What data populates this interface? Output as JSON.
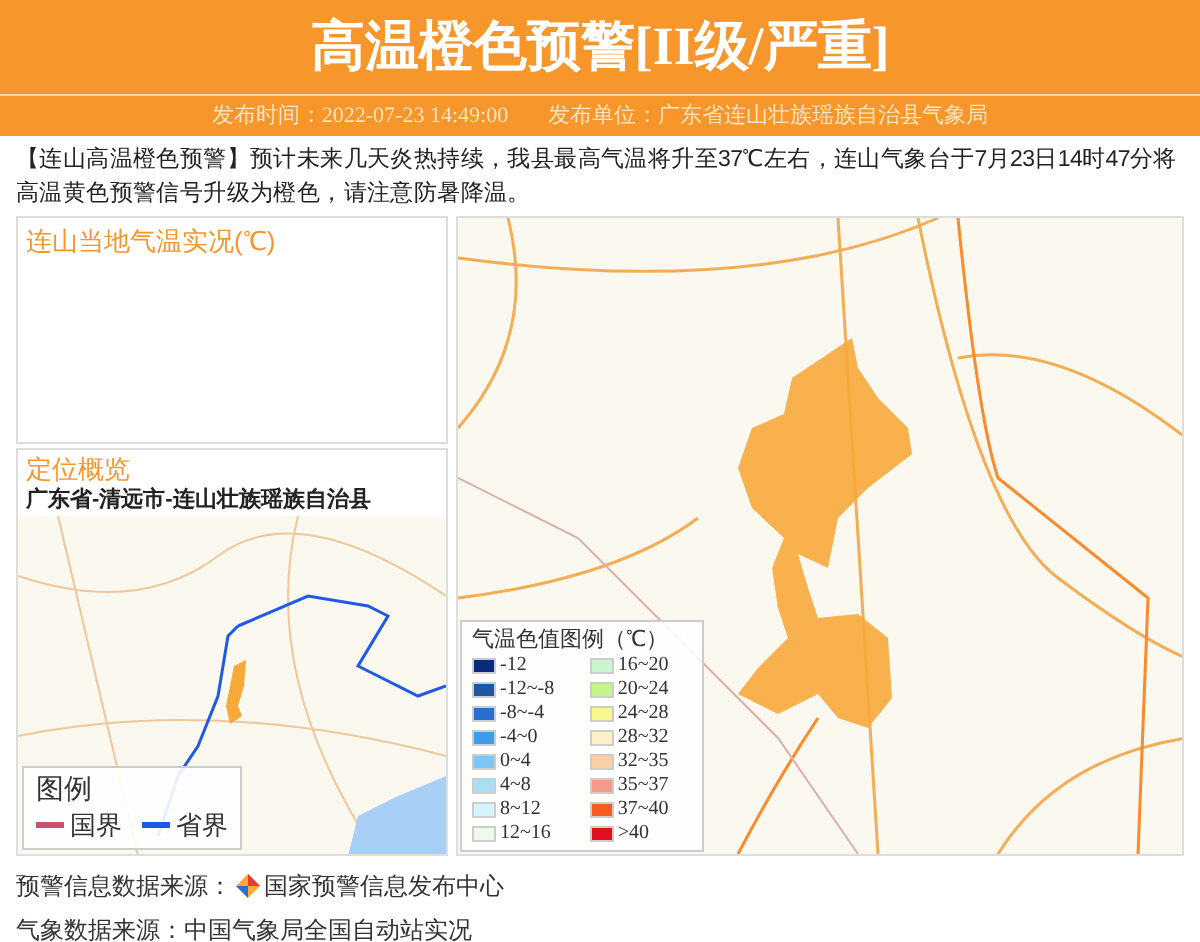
{
  "header": {
    "title": "高温橙色预警[II级/严重]",
    "publish_time": "发布时间：2022-07-23 14:49:00",
    "publisher": "发布单位：广东省连山壮族瑶族自治县气象局"
  },
  "message": "【连山高温橙色预警】预计未来几天炎热持续，我县最高气温将升至37℃左右，连山气象台于7月23日14时47分将高温黄色预警信号升级为橙色，请注意防暑降温。",
  "temperature_panel": {
    "title": "连山当地气温实况(℃)"
  },
  "location_panel": {
    "title": "定位概览",
    "region": "广东省-清远市-连山壮族瑶族自治县",
    "legend": {
      "title": "图例",
      "items": [
        {
          "label": "国界",
          "color": "#c8506a"
        },
        {
          "label": "省界",
          "color": "#1e5ae6"
        }
      ]
    }
  },
  "map_legend": {
    "title": "气温色值图例（℃）",
    "items": [
      {
        "label": "-12",
        "color": "#0a2a7a"
      },
      {
        "label": "-12~-8",
        "color": "#1d56a6"
      },
      {
        "label": "-8~-4",
        "color": "#2a6fd0"
      },
      {
        "label": "-4~0",
        "color": "#3d9be8"
      },
      {
        "label": "0~4",
        "color": "#7cc8f5"
      },
      {
        "label": "4~8",
        "color": "#a9dff2"
      },
      {
        "label": "8~12",
        "color": "#d4f6fb"
      },
      {
        "label": "12~16",
        "color": "#eefbea"
      },
      {
        "label": "16~20",
        "color": "#ccf5cf"
      },
      {
        "label": "20~24",
        "color": "#c2f58a"
      },
      {
        "label": "24~28",
        "color": "#f8f88e"
      },
      {
        "label": "28~32",
        "color": "#fdf0c8"
      },
      {
        "label": "32~35",
        "color": "#fbcfa5"
      },
      {
        "label": "35~37",
        "color": "#f59a8a"
      },
      {
        "label": "37~40",
        "color": "#f85a22"
      },
      {
        "label": ">40",
        "color": "#e01020"
      }
    ]
  },
  "footer": [
    "预警信息数据来源：",
    "国家预警信息发布中心",
    "气象数据来源：中国气象局全国自动站实况"
  ]
}
